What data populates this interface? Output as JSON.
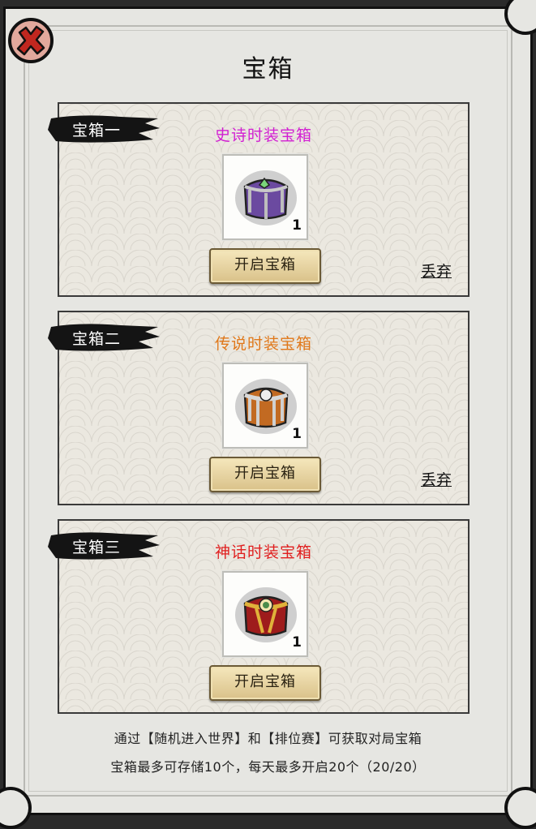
{
  "window": {
    "title": "宝箱"
  },
  "close_icon": "close-x-icon",
  "chests": [
    {
      "tag": "宝箱一",
      "name": "史诗时装宝箱",
      "name_color": "#d21fd2",
      "quantity": "1",
      "chest_icon": "purple-chest-icon",
      "open_label": "开启宝箱",
      "discard_label": "丢弃"
    },
    {
      "tag": "宝箱二",
      "name": "传说时装宝箱",
      "name_color": "#e0781a",
      "quantity": "1",
      "chest_icon": "silver-orange-chest-icon",
      "open_label": "开启宝箱",
      "discard_label": "丢弃"
    },
    {
      "tag": "宝箱三",
      "name": "神话时装宝箱",
      "name_color": "#e01e1e",
      "quantity": "1",
      "chest_icon": "red-gold-chest-icon",
      "open_label": "开启宝箱",
      "discard_label": null
    }
  ],
  "footer": {
    "line1": "通过【随机进入世界】和【排位赛】可获取对局宝箱",
    "line2": "宝箱最多可存储10个，每天最多开启20个（20/20）"
  }
}
